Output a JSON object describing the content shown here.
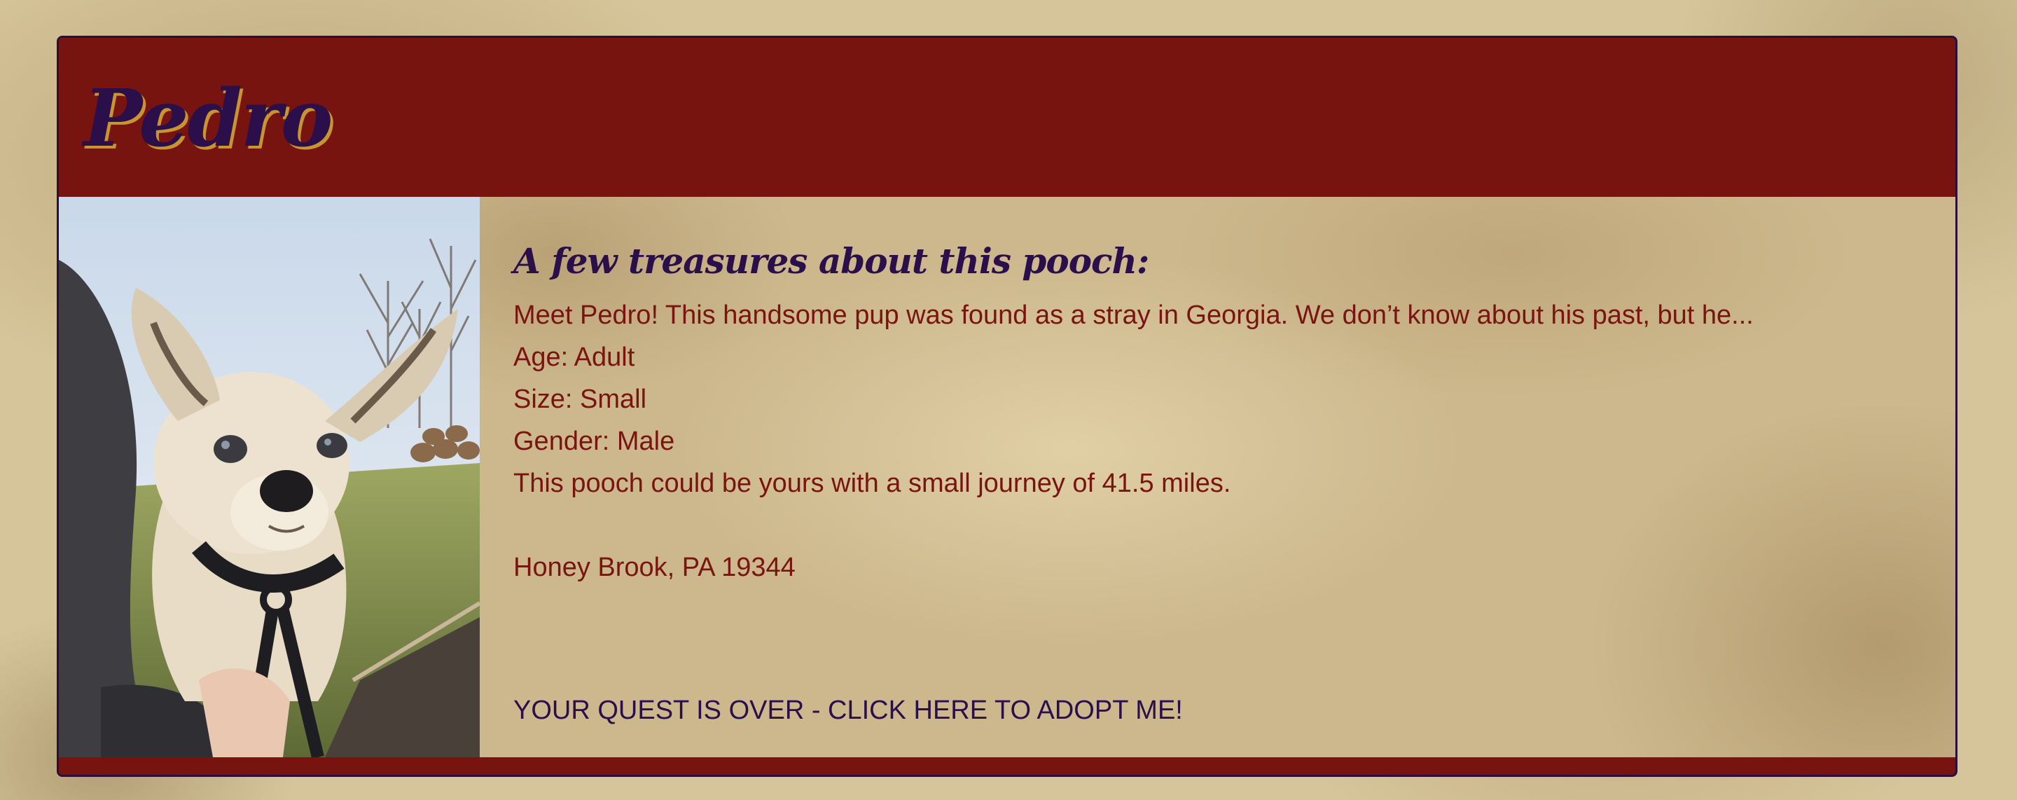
{
  "pet": {
    "name": "Pedro"
  },
  "details": {
    "heading": "A few treasures about this pooch:",
    "description": "Meet Pedro! This handsome pup was found as a stray in Georgia. We don’t know about his past, but he...",
    "age": "Age: Adult",
    "size": "Size: Small",
    "gender": "Gender: Male",
    "distance": "This pooch could be yours with a small journey of 41.5 miles.",
    "location": "Honey Brook, PA 19344",
    "adopt_link": "YOUR QUEST IS OVER - CLICK HERE TO ADOPT ME!"
  },
  "colors": {
    "header_red": "#78140f",
    "title_purple": "#2a0f4a",
    "text_red": "#7a1410",
    "shadow_gold": "#c8952e"
  }
}
